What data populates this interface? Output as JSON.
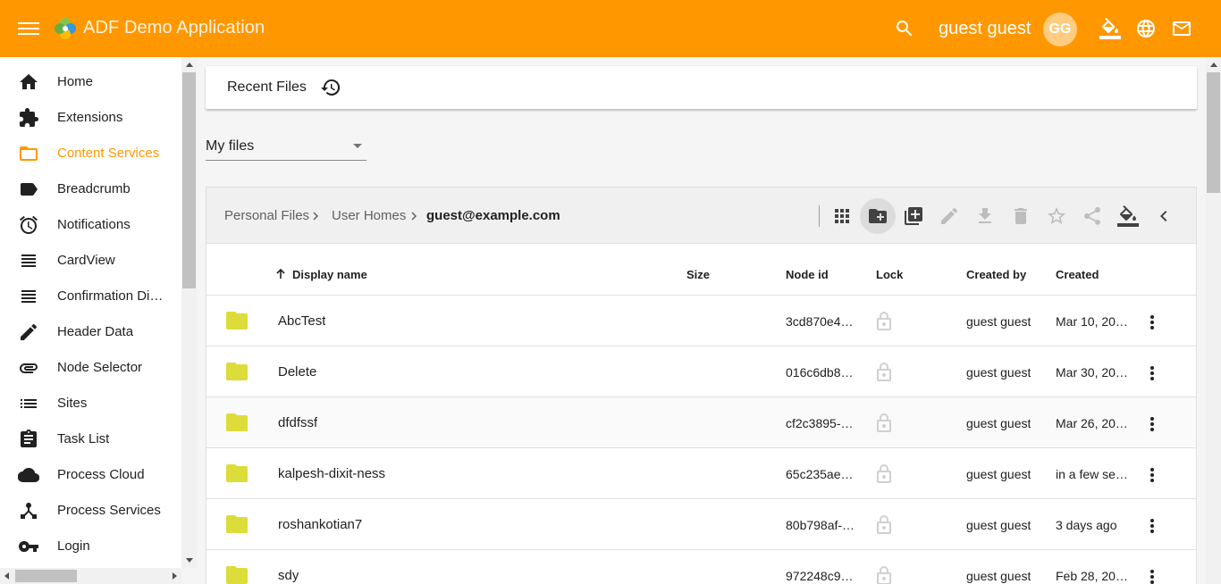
{
  "header": {
    "app_title": "ADF Demo Application",
    "user_name": "guest guest",
    "avatar_initials": "GG",
    "accent_color": "#ff9800",
    "icons": [
      "menu-icon",
      "search-icon",
      "theme-picker-icon",
      "language-icon",
      "mail-icon"
    ]
  },
  "sidebar": {
    "items": [
      {
        "label": "Home",
        "icon": "home-icon"
      },
      {
        "label": "Extensions",
        "icon": "extension-icon"
      },
      {
        "label": "Content Services",
        "icon": "folder-icon",
        "active": true
      },
      {
        "label": "Breadcrumb",
        "icon": "label-icon"
      },
      {
        "label": "Notifications",
        "icon": "alarm-icon"
      },
      {
        "label": "CardView",
        "icon": "view-headline-icon"
      },
      {
        "label": "Confirmation Dialog",
        "icon": "view-headline-icon"
      },
      {
        "label": "Header Data",
        "icon": "edit-icon"
      },
      {
        "label": "Node Selector",
        "icon": "attachment-icon"
      },
      {
        "label": "Sites",
        "icon": "list-icon"
      },
      {
        "label": "Task List",
        "icon": "assignment-icon"
      },
      {
        "label": "Process Cloud",
        "icon": "cloud-icon"
      },
      {
        "label": "Process Services",
        "icon": "device-hub-icon"
      },
      {
        "label": "Login",
        "icon": "vpn-key-icon"
      }
    ]
  },
  "recent": {
    "label": "Recent Files",
    "icon": "history-icon"
  },
  "site_selector": {
    "selected": "My files"
  },
  "breadcrumb": {
    "items": [
      "Personal Files",
      "User Homes",
      "guest@example.com"
    ]
  },
  "toolbar": {
    "buttons": [
      "grid-view-icon",
      "create-folder-icon",
      "upload-icon",
      "edit-icon",
      "download-icon",
      "delete-icon",
      "favorite-icon",
      "share-icon",
      "color-picker-icon",
      "chevron-left-icon"
    ]
  },
  "table": {
    "columns": {
      "display_name": "Display name",
      "size": "Size",
      "node_id": "Node id",
      "lock": "Lock",
      "created_by": "Created by",
      "created": "Created"
    },
    "rows": [
      {
        "name": "AbcTest",
        "size": "",
        "node_id": "3cd870e4…",
        "created_by": "guest guest",
        "created": "Mar 10, 20…"
      },
      {
        "name": "Delete",
        "size": "",
        "node_id": "016c6db8…",
        "created_by": "guest guest",
        "created": "Mar 30, 20…"
      },
      {
        "name": "dfdfssf",
        "size": "",
        "node_id": "cf2c3895-…",
        "created_by": "guest guest",
        "created": "Mar 26, 20…"
      },
      {
        "name": "kalpesh-dixit-ness",
        "size": "",
        "node_id": "65c235ae…",
        "created_by": "guest guest",
        "created": "in a few se…"
      },
      {
        "name": "roshankotian7",
        "size": "",
        "node_id": "80b798af-…",
        "created_by": "guest guest",
        "created": "3 days ago"
      },
      {
        "name": "sdy",
        "size": "",
        "node_id": "972248c9…",
        "created_by": "guest guest",
        "created": "Feb 28, 20…"
      }
    ]
  }
}
